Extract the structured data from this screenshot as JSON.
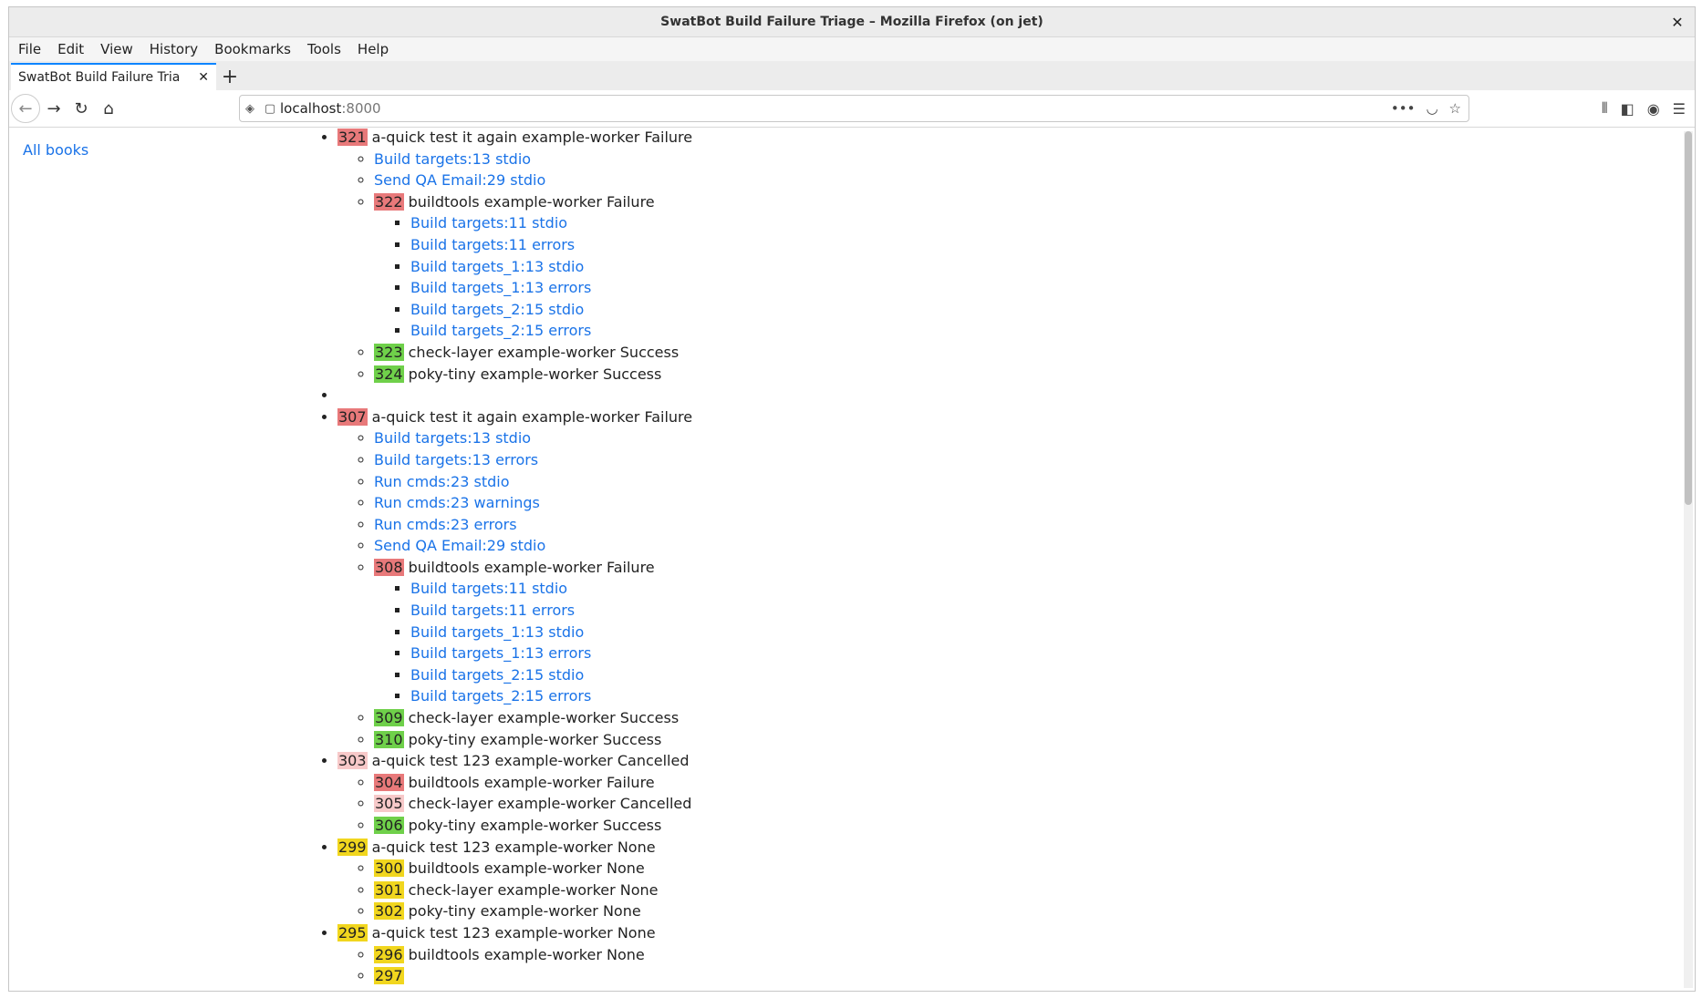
{
  "window": {
    "title": "SwatBot Build Failure Triage – Mozilla Firefox (on jet)"
  },
  "menu": [
    "File",
    "Edit",
    "View",
    "History",
    "Bookmarks",
    "Tools",
    "Help"
  ],
  "tab": {
    "title": "SwatBot Build Failure Tria"
  },
  "url": {
    "host": "localhost",
    "port": ":8000"
  },
  "sidebar": {
    "all_books": "All books"
  },
  "colors": {
    "failure": "#e8797a",
    "success": "#6fd04a",
    "cancelled": "#f7c9c9",
    "none": "#f1d61e"
  },
  "builds": [
    {
      "id": "321",
      "status": "failure",
      "text": "a-quick test it again example-worker Failure",
      "children": [
        {
          "link": "Build targets:13 stdio"
        },
        {
          "link": "Send QA Email:29 stdio"
        },
        {
          "id": "322",
          "status": "failure",
          "text": "buildtools example-worker Failure",
          "links": [
            "Build targets:11 stdio",
            "Build targets:11 errors",
            "Build targets_1:13 stdio",
            "Build targets_1:13 errors",
            "Build targets_2:15 stdio",
            "Build targets_2:15 errors"
          ]
        },
        {
          "id": "323",
          "status": "success",
          "text": "check-layer example-worker Success"
        },
        {
          "id": "324",
          "status": "success",
          "text": "poky-tiny example-worker Success"
        }
      ]
    },
    {
      "empty": true
    },
    {
      "id": "307",
      "status": "failure",
      "text": "a-quick test it again example-worker Failure",
      "children": [
        {
          "link": "Build targets:13 stdio"
        },
        {
          "link": "Build targets:13 errors"
        },
        {
          "link": "Run cmds:23 stdio"
        },
        {
          "link": "Run cmds:23 warnings"
        },
        {
          "link": "Run cmds:23 errors"
        },
        {
          "link": "Send QA Email:29 stdio"
        },
        {
          "id": "308",
          "status": "failure",
          "text": "buildtools example-worker Failure",
          "links": [
            "Build targets:11 stdio",
            "Build targets:11 errors",
            "Build targets_1:13 stdio",
            "Build targets_1:13 errors",
            "Build targets_2:15 stdio",
            "Build targets_2:15 errors"
          ]
        },
        {
          "id": "309",
          "status": "success",
          "text": "check-layer example-worker Success"
        },
        {
          "id": "310",
          "status": "success",
          "text": "poky-tiny example-worker Success"
        }
      ]
    },
    {
      "id": "303",
      "status": "cancelled",
      "text": "a-quick test 123 example-worker Cancelled",
      "children": [
        {
          "id": "304",
          "status": "failure",
          "text": "buildtools example-worker Failure"
        },
        {
          "id": "305",
          "status": "cancelled",
          "text": "check-layer example-worker Cancelled"
        },
        {
          "id": "306",
          "status": "success",
          "text": "poky-tiny example-worker Success"
        }
      ]
    },
    {
      "id": "299",
      "status": "none",
      "text": "a-quick test 123 example-worker None",
      "children": [
        {
          "id": "300",
          "status": "none",
          "text": "buildtools example-worker None"
        },
        {
          "id": "301",
          "status": "none",
          "text": "check-layer example-worker None"
        },
        {
          "id": "302",
          "status": "none",
          "text": "poky-tiny example-worker None"
        }
      ]
    },
    {
      "id": "295",
      "status": "none",
      "text": "a-quick test 123 example-worker None",
      "children": [
        {
          "id": "296",
          "status": "none",
          "text": "buildtools example-worker None"
        },
        {
          "id": "297",
          "status": "none",
          "text": ""
        }
      ]
    }
  ]
}
